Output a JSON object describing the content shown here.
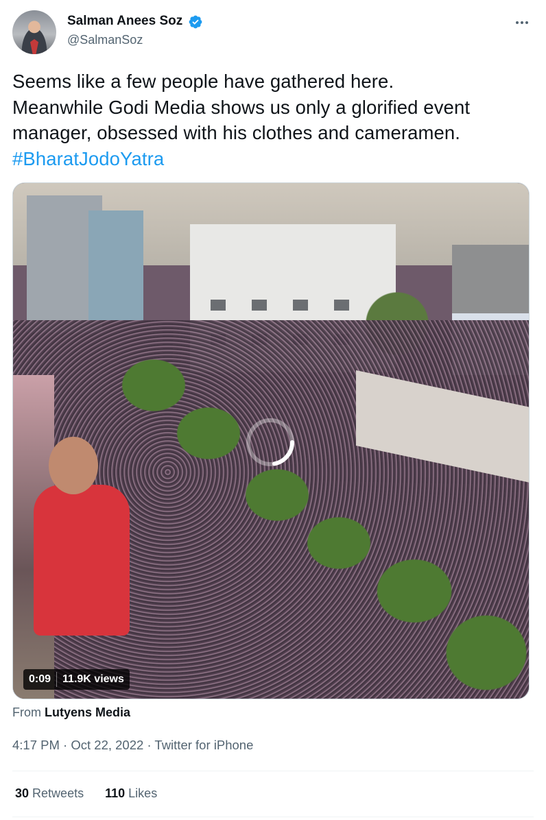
{
  "author": {
    "name": "Salman Anees Soz",
    "handle": "@SalmanSoz",
    "verified": true
  },
  "tweet": {
    "lines": [
      "Seems like a few people have gathered here.",
      "Meanwhile Godi Media shows us only a glorified event",
      "manager, obsessed with his clothes and cameramen."
    ],
    "hashtag": "#BharatJodoYatra"
  },
  "video": {
    "duration": "0:09",
    "views": "11.9K views",
    "state": "loading"
  },
  "source": {
    "prefix": "From",
    "name": "Lutyens Media"
  },
  "timestamp": {
    "time": "4:17 PM",
    "date": "Oct 22, 2022",
    "client": "Twitter for iPhone",
    "separator": "·"
  },
  "stats": {
    "retweets_count": "30",
    "retweets_label": "Retweets",
    "likes_count": "110",
    "likes_label": "Likes"
  },
  "colors": {
    "accent": "#1d9bf0",
    "secondary_text": "#536471"
  },
  "icons": {
    "verified": "verified-badge-icon",
    "more": "more-options-icon",
    "spinner": "loading-spinner-icon"
  }
}
